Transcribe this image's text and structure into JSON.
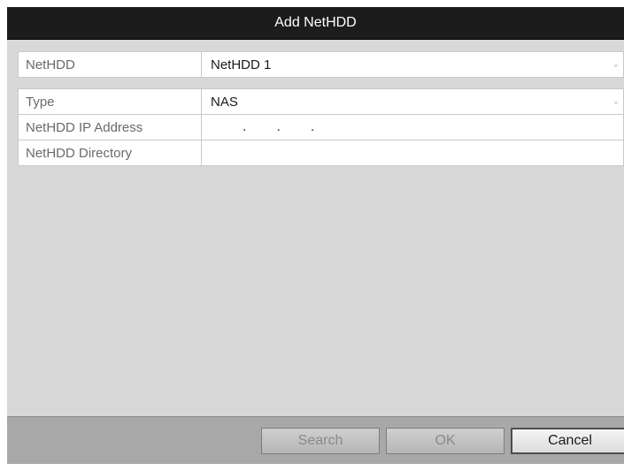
{
  "dialog": {
    "title": "Add NetHDD",
    "fields": {
      "nethdd": {
        "label": "NetHDD",
        "value": "NetHDD 1"
      },
      "type": {
        "label": "Type",
        "value": "NAS"
      },
      "ip": {
        "label": "NetHDD IP Address",
        "dots": [
          ".",
          ".",
          "."
        ]
      },
      "directory": {
        "label": "NetHDD Directory",
        "value": ""
      }
    },
    "buttons": {
      "search": "Search",
      "ok": "OK",
      "cancel": "Cancel"
    }
  },
  "icons": {
    "dropdown": "chevron-down-icon"
  }
}
